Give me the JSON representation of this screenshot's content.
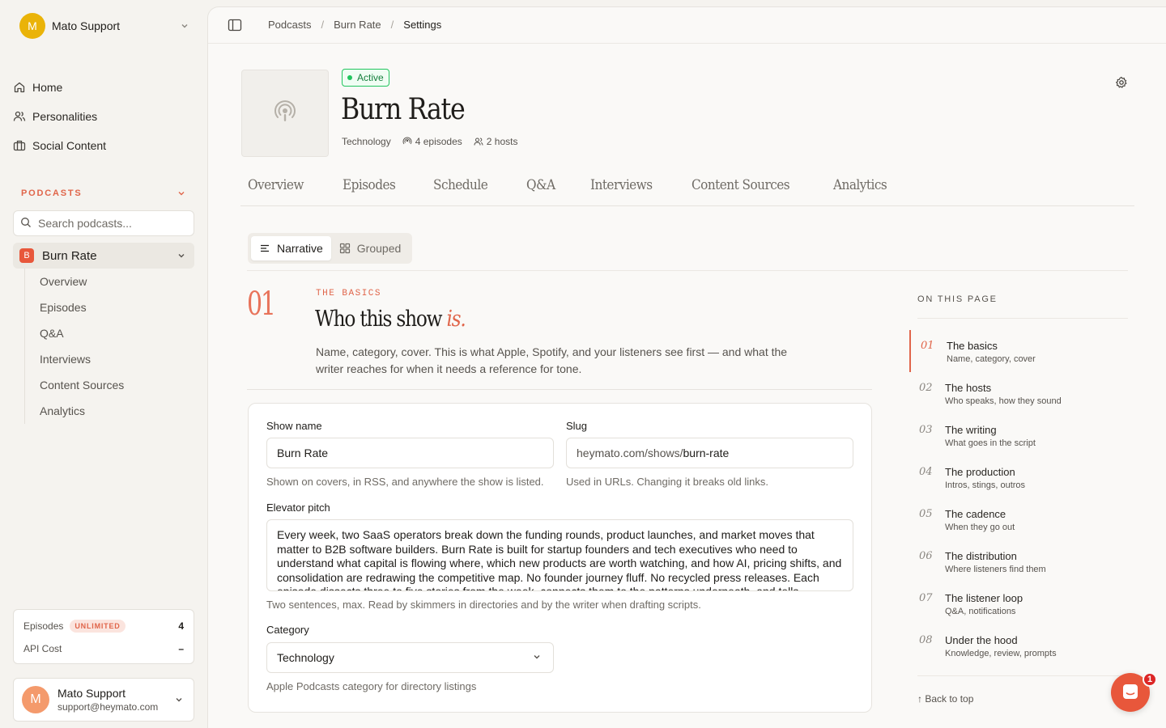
{
  "workspace": {
    "avatar_initial": "M",
    "name": "Mato Support"
  },
  "nav": [
    {
      "icon": "home-icon",
      "label": "Home"
    },
    {
      "icon": "users-icon",
      "label": "Personalities"
    },
    {
      "icon": "briefcase-icon",
      "label": "Social Content"
    }
  ],
  "podcasts_section": {
    "title": "PODCASTS",
    "search_placeholder": "Search podcasts...",
    "active_podcast": {
      "badge": "B",
      "name": "Burn Rate"
    },
    "subnav": [
      "Overview",
      "Episodes",
      "Q&A",
      "Interviews",
      "Content Sources",
      "Analytics"
    ]
  },
  "usage": {
    "episodes_label": "Episodes",
    "episodes_badge": "UNLIMITED",
    "episodes_value": "4",
    "api_label": "API Cost",
    "api_value": "–"
  },
  "user": {
    "initial": "M",
    "name": "Mato Support",
    "email": "support@heymato.com"
  },
  "breadcrumbs": [
    "Podcasts",
    "Burn Rate",
    "Settings"
  ],
  "show": {
    "status": "Active",
    "title": "Burn Rate",
    "category": "Technology",
    "episodes": "4 episodes",
    "hosts": "2 hosts"
  },
  "tabs": [
    "Overview",
    "Episodes",
    "Schedule",
    "Q&A",
    "Interviews",
    "Content Sources",
    "Analytics"
  ],
  "view_toggle": {
    "narrative": "Narrative",
    "grouped": "Grouped"
  },
  "section": {
    "number": "01",
    "eyebrow": "THE BASICS",
    "heading_main": "Who this show",
    "heading_accent": "is.",
    "description": "Name, category, cover. This is what Apple, Spotify, and your listeners see first — and what the writer reaches for when it needs a reference for tone."
  },
  "form": {
    "show_name_label": "Show name",
    "show_name_value": "Burn Rate",
    "show_name_hint": "Shown on covers, in RSS, and anywhere the show is listed.",
    "slug_label": "Slug",
    "slug_prefix": "heymato.com/shows/",
    "slug_value": "burn-rate",
    "slug_hint": "Used in URLs. Changing it breaks old links.",
    "pitch_label": "Elevator pitch",
    "pitch_value": "Every week, two SaaS operators break down the funding rounds, product launches, and market moves that matter to B2B software builders. Burn Rate is built for startup founders and tech executives who need to understand what capital is flowing where, which new products are worth watching, and how AI, pricing shifts, and consolidation are redrawing the competitive map. No founder journey fluff. No recycled press releases. Each episode dissects three to five stories from the week, connects them to the patterns underneath, and tells",
    "pitch_hint": "Two sentences, max. Read by skimmers in directories and by the writer when drafting scripts.",
    "category_label": "Category",
    "category_value": "Technology",
    "category_hint": "Apple Podcasts category for directory listings"
  },
  "toc": {
    "title": "ON THIS PAGE",
    "items": [
      {
        "num": "01",
        "title": "The basics",
        "sub": "Name, category, cover"
      },
      {
        "num": "02",
        "title": "The hosts",
        "sub": "Who speaks, how they sound"
      },
      {
        "num": "03",
        "title": "The writing",
        "sub": "What goes in the script"
      },
      {
        "num": "04",
        "title": "The production",
        "sub": "Intros, stings, outros"
      },
      {
        "num": "05",
        "title": "The cadence",
        "sub": "When they go out"
      },
      {
        "num": "06",
        "title": "The distribution",
        "sub": "Where listeners find them"
      },
      {
        "num": "07",
        "title": "The listener loop",
        "sub": "Q&A, notifications"
      },
      {
        "num": "08",
        "title": "Under the hood",
        "sub": "Knowledge, review, prompts"
      }
    ],
    "back_to_top": "↑ Back to top"
  },
  "chat": {
    "badge_count": "1"
  },
  "colors": {
    "accent": "#e0654a",
    "active_green": "#22c55e",
    "workspace_yellow": "#eab308"
  }
}
